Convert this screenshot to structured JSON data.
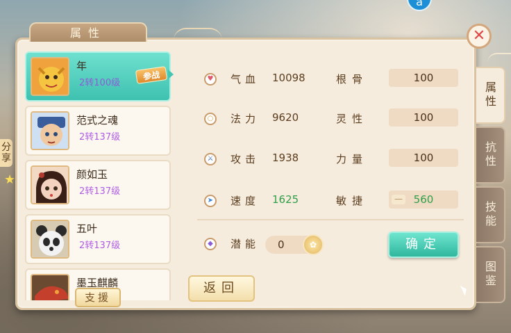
{
  "header": {
    "title": "属性",
    "top_badge": "a"
  },
  "left_edge": {
    "text": "分享"
  },
  "close": {
    "symbol": "✕"
  },
  "characters": [
    {
      "name": "年",
      "level": "2转100级",
      "selected": true,
      "badge": "参战",
      "avatar_colors": [
        "#f5c542",
        "#c8861c"
      ]
    },
    {
      "name": "范式之魂",
      "level": "2转137级",
      "selected": false,
      "avatar_colors": [
        "#3a5d9c",
        "#f1c9a0"
      ]
    },
    {
      "name": "颜如玉",
      "level": "2转137级",
      "selected": false,
      "avatar_colors": [
        "#b23a2e",
        "#f3d3c0"
      ]
    },
    {
      "name": "五叶",
      "level": "2转137级",
      "selected": false,
      "avatar_colors": [
        "#f2f2f2",
        "#2a2a2a"
      ]
    },
    {
      "name": "墨玉麒麟",
      "level": "",
      "selected": false,
      "avatar_colors": [
        "#c4402c",
        "#f0a23c"
      ]
    }
  ],
  "support_button": "支援",
  "stats": [
    {
      "icon": "heart-icon",
      "icon_glyph": "♥",
      "icon_color": "#e05a6a",
      "label": "气血",
      "value": "10098",
      "attr_label": "根骨",
      "attr_value": "100",
      "value_green": false
    },
    {
      "icon": "ring-icon",
      "icon_glyph": "○",
      "icon_color": "#e8a33c",
      "label": "法力",
      "value": "9620",
      "attr_label": "灵性",
      "attr_value": "100",
      "value_green": false
    },
    {
      "icon": "sword-icon",
      "icon_glyph": "⚔",
      "icon_color": "#4a6fa8",
      "label": "攻击",
      "value": "1938",
      "attr_label": "力量",
      "attr_value": "100",
      "value_green": false
    },
    {
      "icon": "speed-icon",
      "icon_glyph": "➤",
      "icon_color": "#3a84d6",
      "label": "速度",
      "value": "1625",
      "attr_label": "敏捷",
      "attr_value": "560",
      "value_green": true
    }
  ],
  "potential": {
    "label": "潜能",
    "value": "0",
    "icon_glyph": "◆"
  },
  "buttons": {
    "confirm": "确定",
    "return": "返回"
  },
  "side_tabs": [
    {
      "label": "属性",
      "active": true
    },
    {
      "label": "抗性",
      "active": false
    },
    {
      "label": "技能",
      "active": false
    },
    {
      "label": "图鉴",
      "active": false
    }
  ]
}
